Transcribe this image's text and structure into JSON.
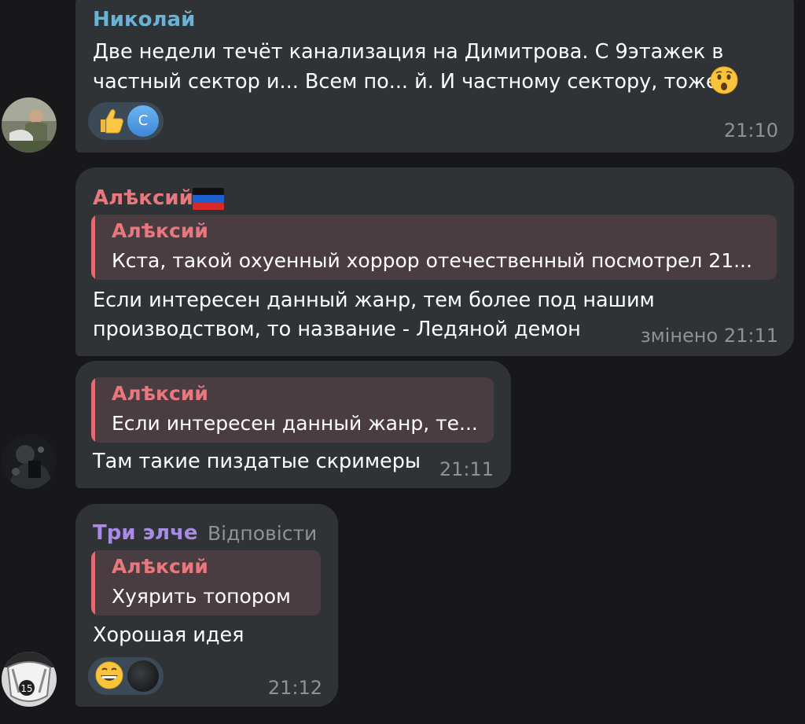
{
  "colors": {
    "background": "#18181b",
    "bubble": "#2f3335",
    "name_nikolay": "#6ab3d6",
    "name_alexiy": "#e8777e",
    "name_tri": "#a98ae6",
    "time": "#8e9296",
    "reply_bg": "#4a3d42",
    "reply_bar": "#e06b72"
  },
  "messages": [
    {
      "sender": "Николай",
      "lines": [
        "Две недели течёт канализация на Димитрова. С 9этажек в",
        "частный сектор и... Всем по... й. И частному сектору, тоже"
      ],
      "inline_emoji": "hushed-face-emoji",
      "reactions": [
        {
          "icon": "thumbs-up-emoji"
        },
        {
          "icon": "avatar-c",
          "letter": "С"
        }
      ],
      "time": "21:10"
    },
    {
      "sender": "Алѣксий",
      "flag": "dpr-flag-icon",
      "reply": {
        "author": "Алѣксий",
        "text": "Кста, такой охуенный хоррор отечественный посмотрел 21..."
      },
      "lines": [
        "Если интересен данный жанр, тем более под нашим",
        "производством, то название - Ледяной демон"
      ],
      "edited": "змінено",
      "time": "21:11"
    },
    {
      "reply": {
        "author": "Алѣксий",
        "text": "Если интересен данный жанр, те..."
      },
      "lines": [
        "Там такие пиздатые скримеры"
      ],
      "time": "21:11"
    },
    {
      "sender": "Три элче",
      "reply_action": "Відповісти",
      "reply": {
        "author": "Алѣксий",
        "text": "Хуярить топором"
      },
      "lines": [
        "Хорошая идея"
      ],
      "reactions": [
        {
          "icon": "grinning-face-emoji"
        },
        {
          "icon": "user-avatar-dark"
        }
      ],
      "time": "21:12"
    }
  ]
}
